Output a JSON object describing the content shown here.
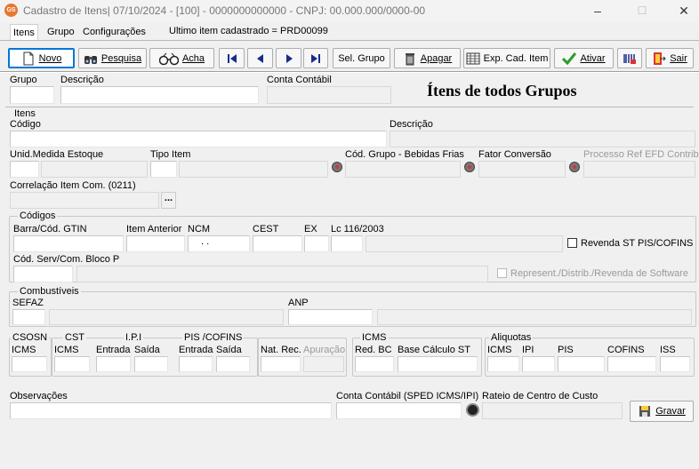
{
  "window": {
    "title": "Cadastro de Itens| 07/10/2024 - [100] - 0000000000000 - CNPJ: 00.000.000/0000-00",
    "app_icon_text": "GS",
    "minimize": "–",
    "maximize": "☐",
    "close": "✕"
  },
  "tabs": [
    "Itens",
    "Grupo",
    "Configurações"
  ],
  "last_item": "Ultimo item cadastrado = PRD00099",
  "toolbar": {
    "novo": "Novo",
    "pesquisa": "Pesquisa",
    "acha": "Acha",
    "sel_grupo": "Sel. Grupo",
    "apagar": "Apagar",
    "exp_cad_item": "Exp. Cad. Item",
    "ativar": "Ativar",
    "sair": "Sair"
  },
  "header": {
    "grupo": "Grupo",
    "descricao": "Descrição",
    "conta_contabil": "Conta Contábil",
    "title": "Ítens de todos Grupos"
  },
  "itens": {
    "group": "Itens",
    "codigo": "Código",
    "descricao": "Descrição",
    "unid_medida": "Unid.Medida Estoque",
    "tipo_item": "Tipo Item",
    "cod_grupo_bebidas": "Cód. Grupo - Bebidas Frias",
    "fator_conversao": "Fator Conversão",
    "processo_ref": "Processo Ref EFD Contrib.",
    "correlacao": "Correlação Item Com. (0211)",
    "ellipsis": "..."
  },
  "codigos": {
    "group": "Códigos",
    "barra": "Barra/Cód. GTIN",
    "item_anterior": "Item Anterior",
    "ncm": "NCM",
    "ncm_value": ". .",
    "cest": "CEST",
    "ex": "EX",
    "lc": "Lc 116/2003",
    "revenda_st": "Revenda ST PIS/COFINS",
    "cod_serv": "Cód. Serv/Com. Bloco P",
    "represent": "Represent./Distrib./Revenda de Software"
  },
  "combustiveis": {
    "group": "Combustíveis",
    "sefaz": "SEFAZ",
    "anp": "ANP"
  },
  "tributos": {
    "csosn": "CSOSN",
    "cst": "CST",
    "ipi": "I.P.I",
    "pis_cofins": "PIS /COFINS",
    "icms": "ICMS",
    "aliquotas": "Aliquotas",
    "icms_label": "ICMS",
    "entrada": "Entrada",
    "saida": "Saída",
    "nat_rec": "Nat. Rec.",
    "apuracao": "Apuração",
    "red_bc": "Red. BC",
    "base_calc_st": "Base Cálculo ST",
    "ipi_short": "IPI",
    "pis": "PIS",
    "cofins": "COFINS",
    "iss": "ISS"
  },
  "footer": {
    "observacoes": "Observações",
    "conta_contabil_sped": "Conta Contábil (SPED ICMS/IPI)",
    "rateio": "Rateio de Centro de Custo",
    "gravar": "Gravar"
  }
}
